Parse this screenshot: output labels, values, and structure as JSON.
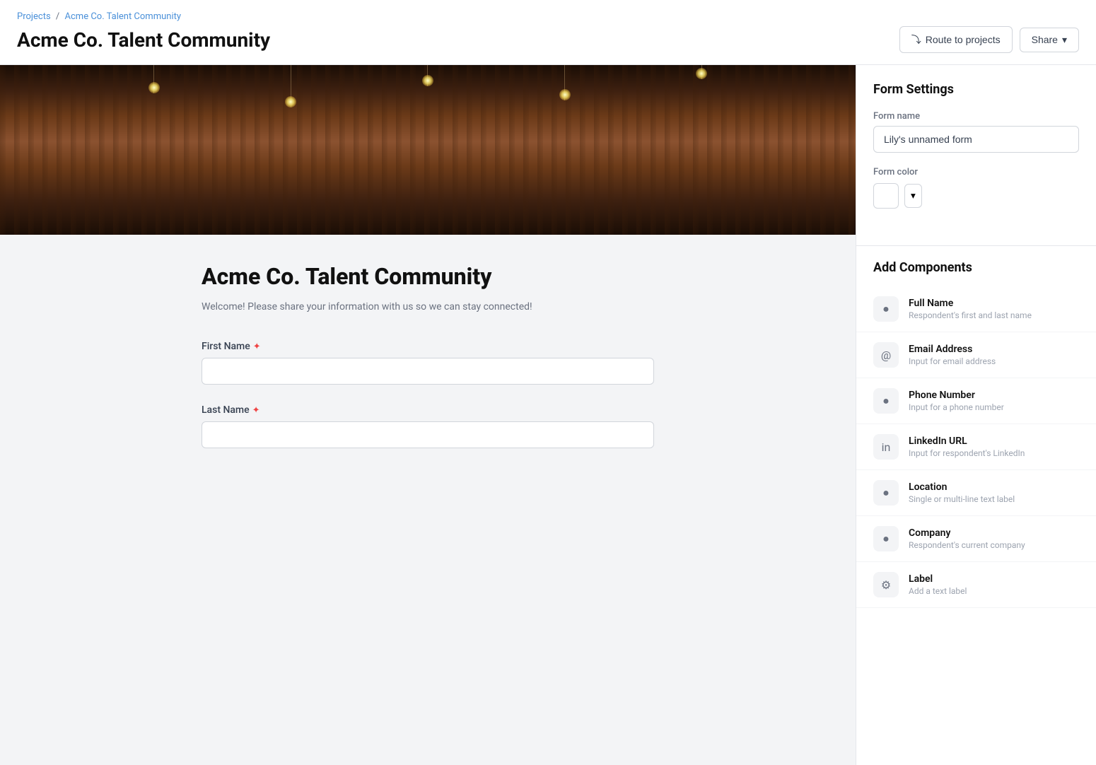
{
  "breadcrumb": {
    "projects_label": "Projects",
    "separator": "/",
    "current_label": "Acme Co. Talent Community"
  },
  "header": {
    "title": "Acme Co. Talent Community",
    "route_button_label": "Route to projects",
    "share_button_label": "Share"
  },
  "form_preview": {
    "heading": "Acme Co. Talent Community",
    "subheading": "Welcome! Please share your information with us so we can stay connected!",
    "fields": [
      {
        "label": "First Name",
        "required": true,
        "placeholder": ""
      },
      {
        "label": "Last Name",
        "required": true,
        "placeholder": ""
      }
    ]
  },
  "sidebar": {
    "form_settings_title": "Form Settings",
    "form_name_label": "Form name",
    "form_name_value": "Lily's unnamed form",
    "form_color_label": "Form color",
    "add_components_title": "Add Components",
    "components": [
      {
        "name": "Full Name",
        "desc": "Respondent's first and last name",
        "icon": "person"
      },
      {
        "name": "Email Address",
        "desc": "Input for email address",
        "icon": "at"
      },
      {
        "name": "Phone Number",
        "desc": "Input for a phone number",
        "icon": "phone"
      },
      {
        "name": "LinkedIn URL",
        "desc": "Input for respondent's LinkedIn",
        "icon": "linkedin"
      },
      {
        "name": "Location",
        "desc": "Single or multi-line text label",
        "icon": "location"
      },
      {
        "name": "Company",
        "desc": "Respondent's current company",
        "icon": "company"
      },
      {
        "name": "Label",
        "desc": "Add a text label",
        "icon": "label"
      }
    ]
  },
  "icons": {
    "person": "👤",
    "at": "@",
    "phone": "📱",
    "linkedin": "in",
    "location": "📍",
    "company": "🏢",
    "label": "🏷",
    "route": "⤵",
    "chevron_down": "▾"
  }
}
